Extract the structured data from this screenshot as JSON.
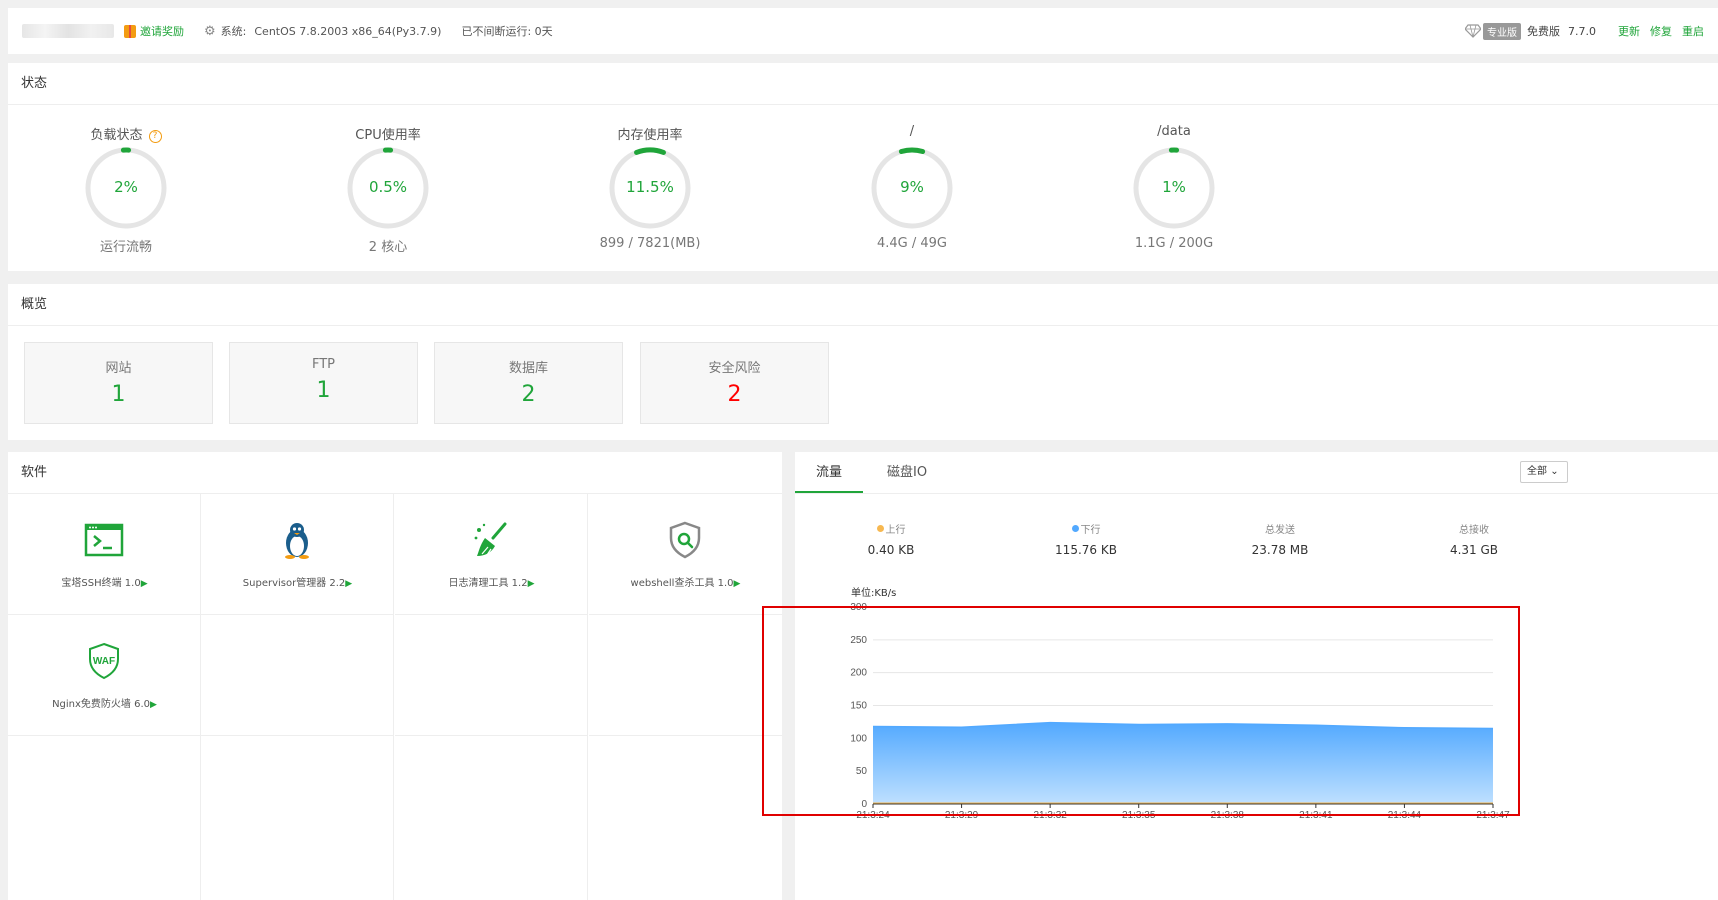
{
  "topbar": {
    "invite": "邀请奖励",
    "sys_label": "系统:",
    "sys_value": "CentOS 7.8.2003 x86_64(Py3.7.9)",
    "uptime": "已不间断运行: 0天",
    "pro_badge": "专业版",
    "edition": "免费版",
    "version": "7.7.0",
    "links": [
      "更新",
      "修复",
      "重启"
    ]
  },
  "status": {
    "title": "状态",
    "gauges": [
      {
        "title": "负载状态",
        "value": "2%",
        "sub": "运行流畅",
        "percent": 2
      },
      {
        "title": "CPU使用率",
        "value": "0.5%",
        "sub": "2 核心",
        "percent": 0.5
      },
      {
        "title": "内存使用率",
        "value": "11.5%",
        "sub": "899 / 7821(MB)",
        "percent": 11.5
      },
      {
        "title": "/",
        "value": "9%",
        "sub": "4.4G / 49G",
        "percent": 9
      },
      {
        "title": "/data",
        "value": "1%",
        "sub": "1.1G / 200G",
        "percent": 1
      }
    ]
  },
  "overview": {
    "title": "概览",
    "cards": [
      {
        "label": "网站",
        "value": "1"
      },
      {
        "label": "FTP",
        "value": "1"
      },
      {
        "label": "数据库",
        "value": "2"
      },
      {
        "label": "安全风险",
        "value": "2"
      }
    ]
  },
  "software": {
    "title": "软件",
    "items": [
      {
        "name": "宝塔SSH终端 1.0",
        "icon": "terminal-icon"
      },
      {
        "name": "Supervisor管理器 2.2",
        "icon": "penguin-icon"
      },
      {
        "name": "日志清理工具 1.2",
        "icon": "broom-icon"
      },
      {
        "name": "webshell查杀工具 1.0",
        "icon": "shield-search-icon"
      },
      {
        "name": "Nginx免费防火墙 6.0",
        "icon": "waf-shield-icon"
      }
    ],
    "waf_text": "WAF"
  },
  "traffic": {
    "tabs": [
      "流量",
      "磁盘IO"
    ],
    "select": "全部",
    "stats": [
      {
        "label": "上行",
        "value": "0.40 KB",
        "dot": "#f7b851"
      },
      {
        "label": "下行",
        "value": "115.76 KB",
        "dot": "#52a9ff"
      },
      {
        "label": "总发送",
        "value": "23.78 MB"
      },
      {
        "label": "总接收",
        "value": "4.31 GB"
      }
    ],
    "unit": "单位:KB/s"
  },
  "colors": {
    "accent": "#20a53a",
    "danger": "#ff0000",
    "download": "#52a9ff",
    "upload": "#f7b851"
  },
  "chart_data": {
    "type": "area",
    "ylabel": "单位:KB/s",
    "ylim": [
      0,
      300
    ],
    "yticks": [
      0,
      50,
      100,
      150,
      200,
      250,
      300
    ],
    "x": [
      "21:3:24",
      "21:3:29",
      "21:3:32",
      "21:3:35",
      "21:3:38",
      "21:3:41",
      "21:3:44",
      "21:3:47"
    ],
    "series": [
      {
        "name": "上行",
        "color": "#f7b851",
        "values": [
          1,
          1,
          1,
          1,
          1,
          1,
          1,
          1
        ]
      },
      {
        "name": "下行",
        "color": "#52a9ff",
        "values": [
          118,
          117,
          124,
          121,
          122,
          120,
          116,
          115
        ]
      }
    ],
    "grid": true
  }
}
